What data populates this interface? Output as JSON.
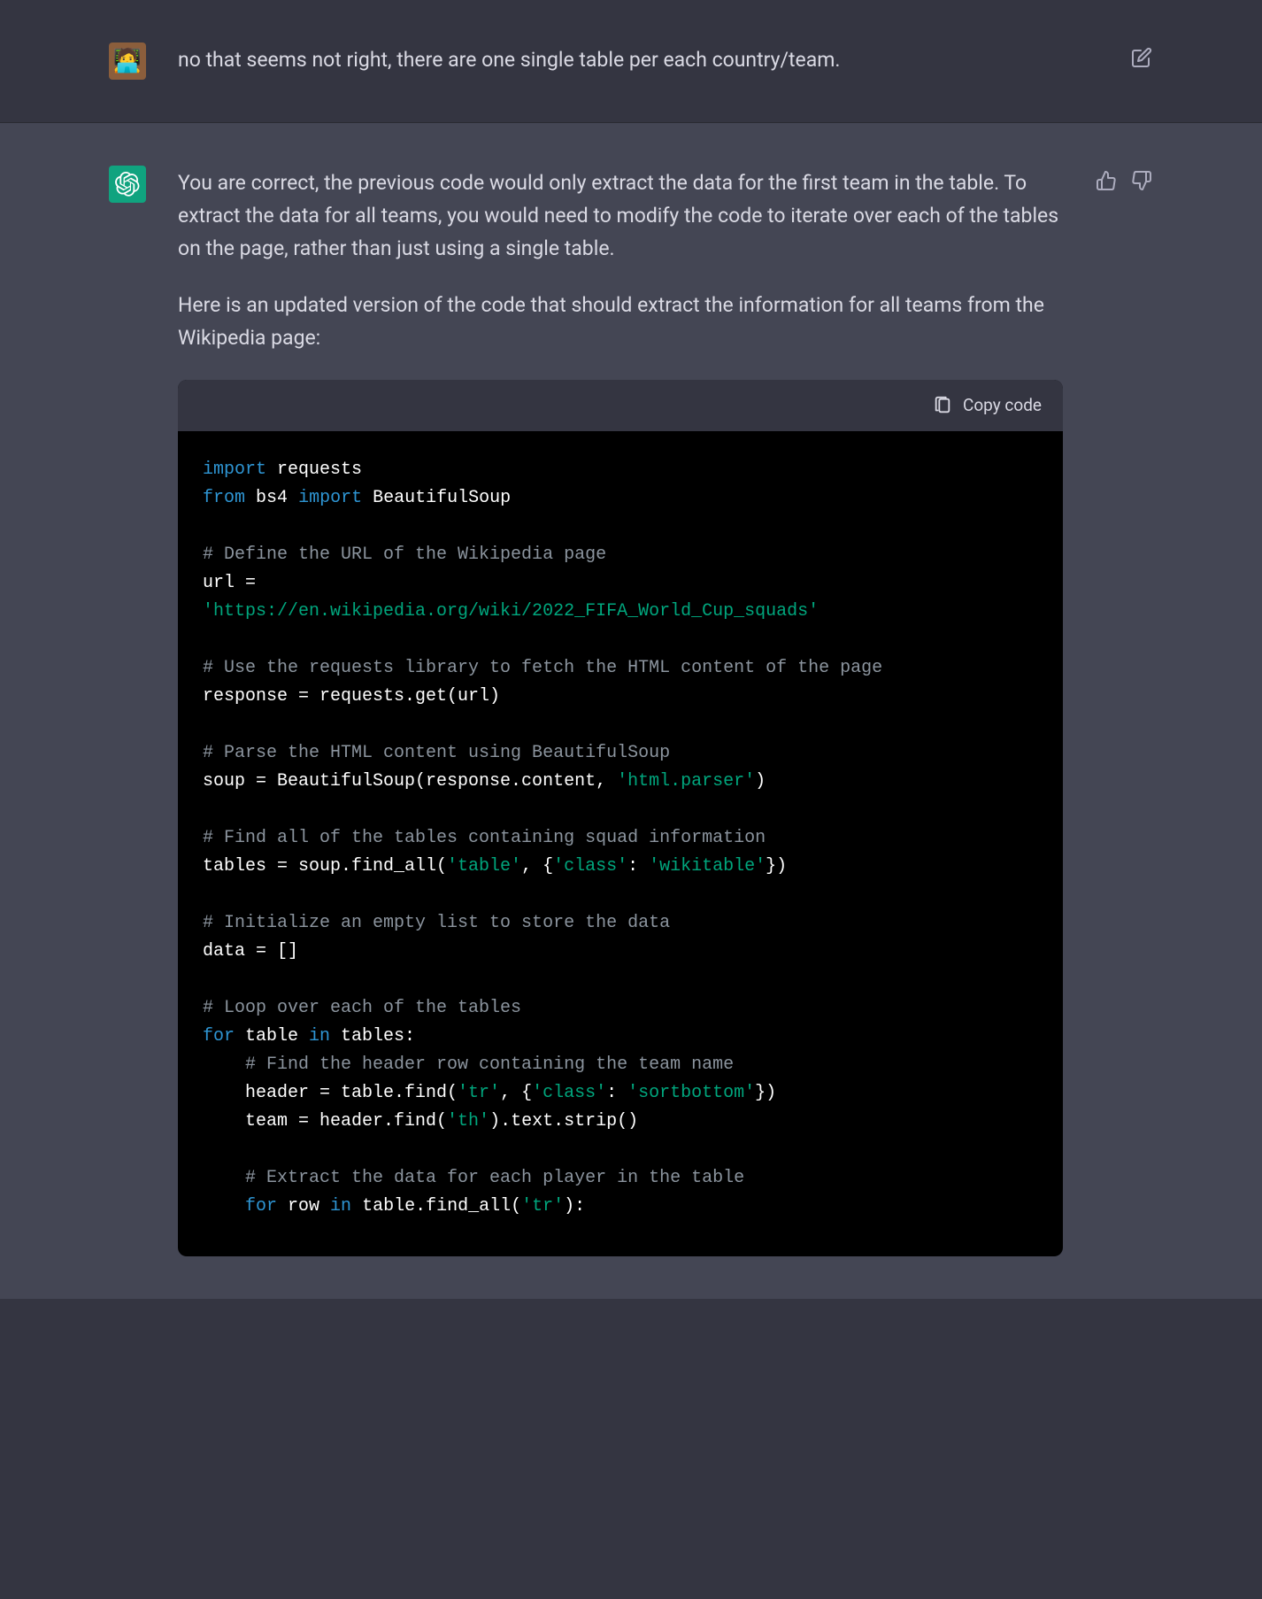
{
  "user_message": {
    "text": "no that seems not right, there are one single table per each country/team."
  },
  "assistant_message": {
    "paragraphs": [
      "You are correct, the previous code would only extract the data for the first team in the table. To extract the data for all teams, you would need to modify the code to iterate over each of the tables on the page, rather than just using a single table.",
      "Here is an updated version of the code that should extract the information for all teams from the Wikipedia page:"
    ]
  },
  "code": {
    "copy_label": "Copy code",
    "tokens": {
      "import": "import",
      "from": "from",
      "in": "in",
      "for": "for",
      "requests": "requests",
      "bs4": "bs4",
      "BeautifulSoup": "BeautifulSoup",
      "c_url": "# Define the URL of the Wikipedia page",
      "url_eq": "url =",
      "url_str": "'https://en.wikipedia.org/wiki/2022_FIFA_World_Cup_squads'",
      "c_req": "# Use the requests library to fetch the HTML content of the page",
      "resp_line": "response = requests.get(url)",
      "c_parse": "# Parse the HTML content using BeautifulSoup",
      "soup_pre": "soup = BeautifulSoup(response.content, ",
      "soup_str": "'html.parser'",
      "soup_post": ")",
      "c_find": "# Find all of the tables containing squad information",
      "tables_pre": "tables = soup.find_all(",
      "tables_s1": "'table'",
      "tables_mid1": ", {",
      "tables_s2": "'class'",
      "tables_mid2": ": ",
      "tables_s3": "'wikitable'",
      "tables_post": "})",
      "c_init": "# Initialize an empty list to store the data",
      "data_line": "data = []",
      "c_loop": "# Loop over each of the tables",
      "for_var": " table ",
      "for_tail": " tables:",
      "c_header": "    # Find the header row containing the team name",
      "hdr_pre": "    header = table.find(",
      "hdr_s1": "'tr'",
      "hdr_mid1": ", {",
      "hdr_s2": "'class'",
      "hdr_mid2": ": ",
      "hdr_s3": "'sortbottom'",
      "hdr_post": "})",
      "team_pre": "    team = header.find(",
      "team_s1": "'th'",
      "team_post": ").text.strip()",
      "c_extract": "    # Extract the data for each player in the table",
      "for2_var": " row ",
      "for2_mid": " table.find_all(",
      "for2_s1": "'tr'",
      "for2_post": "):"
    }
  }
}
